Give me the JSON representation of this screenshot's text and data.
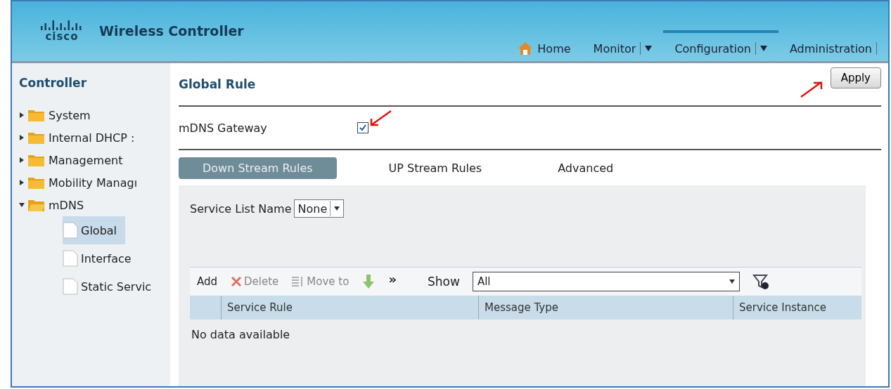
{
  "header": {
    "logo": "cisco",
    "title": "Wireless Controller"
  },
  "nav": [
    {
      "label": "Home",
      "kind": "home",
      "selected": false
    },
    {
      "label": "Monitor",
      "kind": "menu",
      "selected": false
    },
    {
      "label": "Configuration",
      "kind": "menu",
      "selected": true
    },
    {
      "label": "Administration",
      "kind": "plain",
      "selected": false
    }
  ],
  "sidebar": {
    "title": "Controller",
    "items": [
      {
        "label": "System",
        "expanded": false,
        "selected": false
      },
      {
        "label": "Internal DHCP :",
        "expanded": false,
        "selected": false
      },
      {
        "label": "Management",
        "expanded": false,
        "selected": false
      },
      {
        "label": "Mobility Managı",
        "expanded": false,
        "selected": false
      },
      {
        "label": "mDNS",
        "expanded": true,
        "selected": false,
        "children": [
          {
            "label": "Global",
            "selected": true
          },
          {
            "label": "Interface",
            "selected": false
          },
          {
            "label": "Static Servic",
            "selected": false
          }
        ]
      }
    ]
  },
  "page": {
    "title": "Global Rule",
    "apply": "Apply",
    "gateway": {
      "label": "mDNS Gateway",
      "checked": true
    }
  },
  "tabs": [
    {
      "label": "Down Stream Rules",
      "selected": true
    },
    {
      "label": "UP Stream Rules",
      "selected": false
    },
    {
      "label": "Advanced",
      "selected": false
    }
  ],
  "service_list": {
    "label": "Service List Name",
    "value": "None"
  },
  "toolbar": {
    "add": "Add",
    "delete": "Delete",
    "move": "Move to",
    "more": "»",
    "show_label": "Show",
    "show_value": "All"
  },
  "table": {
    "columns": [
      "Service Rule",
      "Message Type",
      "Service Instance"
    ],
    "empty": "No data available"
  }
}
